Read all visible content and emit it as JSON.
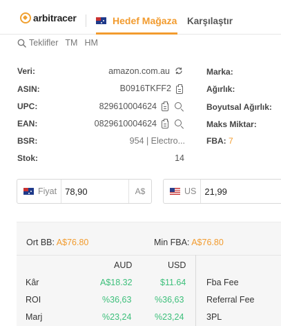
{
  "header": {
    "logo_text": "arbitracer",
    "tab_active": "Hedef Mağaza",
    "tab_inactive": "Karşılaştır"
  },
  "subnav": {
    "items": [
      "Teklifler",
      "TM",
      "HM"
    ]
  },
  "info": {
    "veri_label": "Veri:",
    "veri_value": "amazon.com.au",
    "asin_label": "ASIN:",
    "asin_value": "B0916TKFF2",
    "upc_label": "UPC:",
    "upc_value": "829610004624",
    "ean_label": "EAN:",
    "ean_value": "0829610004624",
    "bsr_label": "BSR:",
    "bsr_value": "954  |  Electro...",
    "stok_label": "Stok:",
    "stok_value": "14",
    "marka_label": "Marka:",
    "agirlik_label": "Ağırlık:",
    "boyutsal_label": "Boyutsal Ağırlık:",
    "maks_label": "Maks Miktar:",
    "fba_label": "FBA:",
    "fba_value": "7"
  },
  "price": {
    "au_label": "Fiyat",
    "au_value": "78,90",
    "au_currency": "A$",
    "us_label": "US",
    "us_value": "21,99"
  },
  "calc": {
    "ort_bb_label": "Ort BB:",
    "ort_bb_value": "A$76.80",
    "min_fba_label": "Min FBA:",
    "min_fba_value": "A$76.80",
    "col_aud": "AUD",
    "col_usd": "USD",
    "rows": [
      {
        "label": "Kâr",
        "aud": "A$18.32",
        "usd": "$11.64"
      },
      {
        "label": "ROI",
        "aud": "%36,63",
        "usd": "%36,63"
      },
      {
        "label": "Marj",
        "aud": "%23,24",
        "usd": "%23,24"
      }
    ],
    "fees": [
      "Fba Fee",
      "Referral Fee",
      "3PL"
    ]
  },
  "colors": {
    "accent": "#f29b2e",
    "positive": "#3cbf7a"
  }
}
